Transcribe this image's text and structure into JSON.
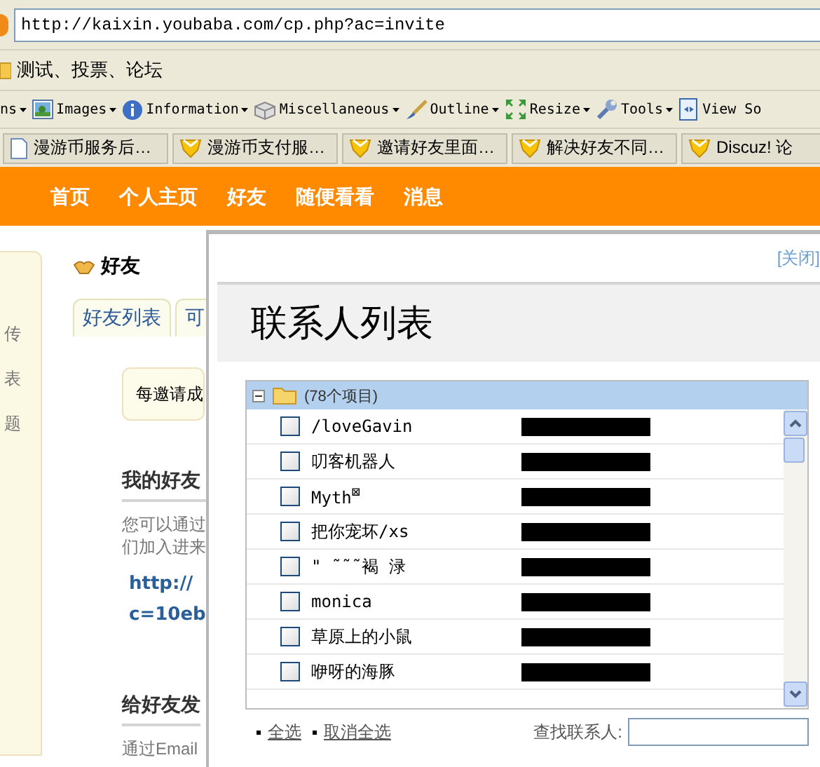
{
  "address_bar": {
    "url": "http://kaixin.youbaba.com/cp.php?ac=invite"
  },
  "bookmarks": [
    {
      "label": "测试、投票、论坛"
    }
  ],
  "toolbar": [
    {
      "label": "ns"
    },
    {
      "label": "Images"
    },
    {
      "label": "Information"
    },
    {
      "label": "Miscellaneous"
    },
    {
      "label": "Outline"
    },
    {
      "label": "Resize"
    },
    {
      "label": "Tools"
    },
    {
      "label": "View So"
    }
  ],
  "browser_tabs": [
    {
      "label": "漫游币服务后…"
    },
    {
      "label": "漫游币支付服…"
    },
    {
      "label": "邀请好友里面…"
    },
    {
      "label": "解决好友不同…"
    },
    {
      "label": "Discuz! 论"
    }
  ],
  "nav": [
    "首页",
    "个人主页",
    "好友",
    "随便看看",
    "消息"
  ],
  "sidebar": {
    "items": [
      "传",
      "表",
      "题"
    ]
  },
  "page": {
    "title": "好友",
    "tabs": [
      "好友列表",
      "可"
    ],
    "notice": "每邀请成",
    "sections": [
      {
        "heading": "我的好友",
        "text": [
          "您可以通过",
          "们加入进来"
        ],
        "link": [
          "http://",
          "c=10eb"
        ]
      },
      {
        "heading": "给好友发",
        "text": [
          "通过Email"
        ]
      }
    ]
  },
  "dialog": {
    "close": "[关闭]",
    "title": "联系人列表",
    "list": {
      "header": "(78个项目)",
      "expanded": true,
      "rows": [
        {
          "name": "/loveGavin",
          "checked": false
        },
        {
          "name": "叨客机器人",
          "checked": false
        },
        {
          "name": "Myth$^{⊠}$",
          "checked": false
        },
        {
          "name": "把你宠坏/xs",
          "checked": false
        },
        {
          "name": "\" ˜˜˜褐 渌",
          "checked": false
        },
        {
          "name": "monica",
          "checked": false
        },
        {
          "name": "草原上的小鼠",
          "checked": false
        },
        {
          "name": "咿呀的海豚",
          "checked": false
        }
      ]
    },
    "select_all": "全选",
    "deselect_all": "取消全选",
    "search_label": "查找联系人:"
  }
}
